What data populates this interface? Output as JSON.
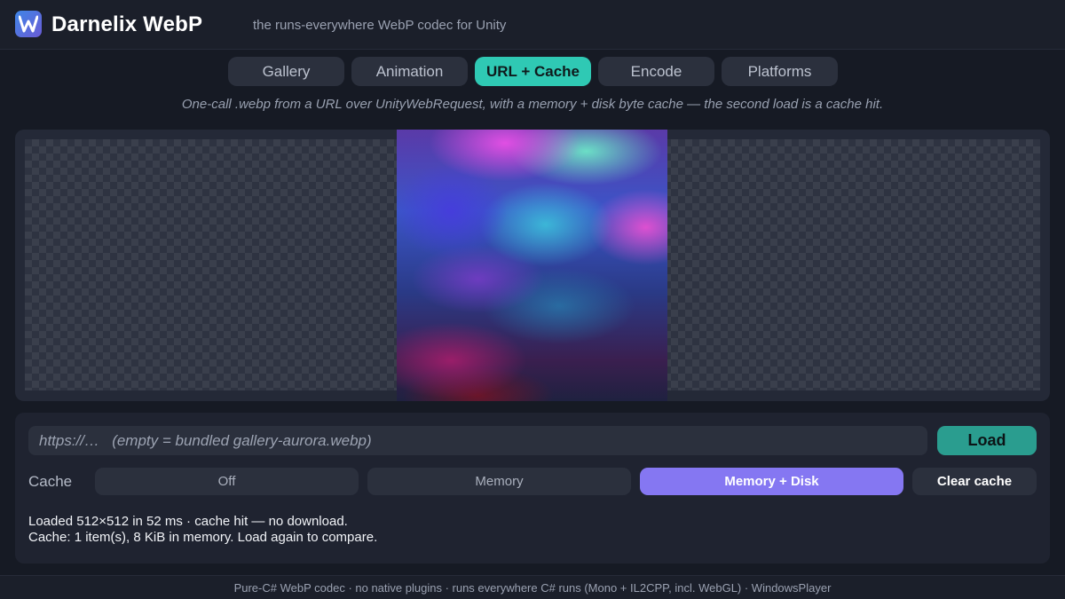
{
  "header": {
    "title": "Darnelix WebP",
    "tagline": "the runs-everywhere WebP codec for Unity",
    "logo_letter": "W"
  },
  "tabs": [
    {
      "label": "Gallery",
      "active": false
    },
    {
      "label": "Animation",
      "active": false
    },
    {
      "label": "URL + Cache",
      "active": true
    },
    {
      "label": "Encode",
      "active": false
    },
    {
      "label": "Platforms",
      "active": false
    }
  ],
  "subtitle": "One-call .webp from a URL over UnityWebRequest, with a memory + disk byte cache — the second load is a cache hit.",
  "preview": {
    "image_name": "gallery-aurora.webp"
  },
  "controls": {
    "url_placeholder": "https://…   (empty = bundled gallery-aurora.webp)",
    "url_value": "",
    "load_label": "Load",
    "cache_label": "Cache",
    "cache_options": [
      {
        "label": "Off",
        "active": false
      },
      {
        "label": "Memory",
        "active": false
      },
      {
        "label": "Memory + Disk",
        "active": true
      }
    ],
    "clear_label": "Clear cache"
  },
  "status": {
    "line1": "Loaded 512×512 in 52 ms · cache hit — no download.",
    "line2": "Cache: 1 item(s), 8 KiB in memory. Load again to compare."
  },
  "footer": {
    "text": "Pure-C# WebP codec · no native plugins · runs everywhere C# runs (Mono + IL2CPP, incl. WebGL) · WindowsPlayer"
  },
  "colors": {
    "accent_tab": "#2fc9b4",
    "accent_cache": "#8577f2",
    "load_button": "#2a9d8f",
    "background": "#161a24"
  }
}
